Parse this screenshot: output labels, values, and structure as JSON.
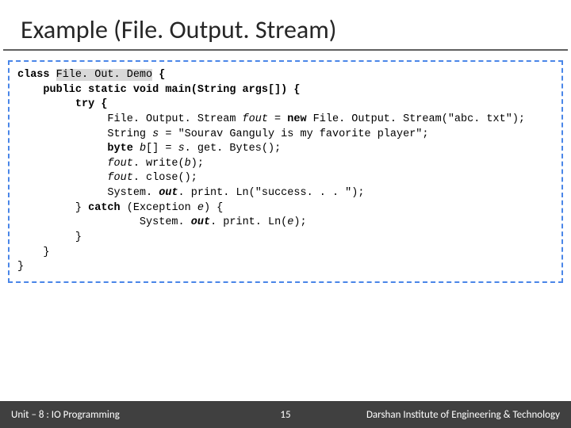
{
  "title": "Example (File. Output. Stream)",
  "code": {
    "l1a": "class ",
    "l1b": "File. Out. Demo",
    "l1c": " {",
    "l2": "    public static void main(String args[]) {",
    "l3": "         try {",
    "l4a": "              File. Output. Stream ",
    "l4b": "fout",
    "l4c": " = ",
    "l4d": "new",
    "l4e": " File. Output. Stream(",
    "l4f": "\"abc. txt\"",
    "l4g": ");",
    "l5a": "              String ",
    "l5b": "s",
    "l5c": " = ",
    "l5d": "\"Sourav Ganguly is my favorite player\"",
    "l5e": ";",
    "l6a": "              byte ",
    "l6b": "b",
    "l6c": "[] = ",
    "l6d": "s",
    "l6e": ". get. Bytes();",
    "l7a": "              ",
    "l7b": "fout",
    "l7c": ". write(",
    "l7d": "b",
    "l7e": ");",
    "l8a": "              ",
    "l8b": "fout",
    "l8c": ". close();",
    "l9a": "              System. ",
    "l9b": "out",
    "l9c": ". print. Ln(",
    "l9d": "\"success. . . \"",
    "l9e": ");",
    "l10a": "         } ",
    "l10b": "catch",
    "l10c": " (Exception ",
    "l10d": "e",
    "l10e": ") {",
    "l11a": "                   System. ",
    "l11b": "out",
    "l11c": ". print. Ln(",
    "l11d": "e",
    "l11e": ");",
    "l12": "         }",
    "l13": "    }",
    "l14": "}"
  },
  "footer": {
    "left": "Unit – 8 : IO Programming",
    "page": "15",
    "right": "Darshan Institute of Engineering & Technology"
  }
}
